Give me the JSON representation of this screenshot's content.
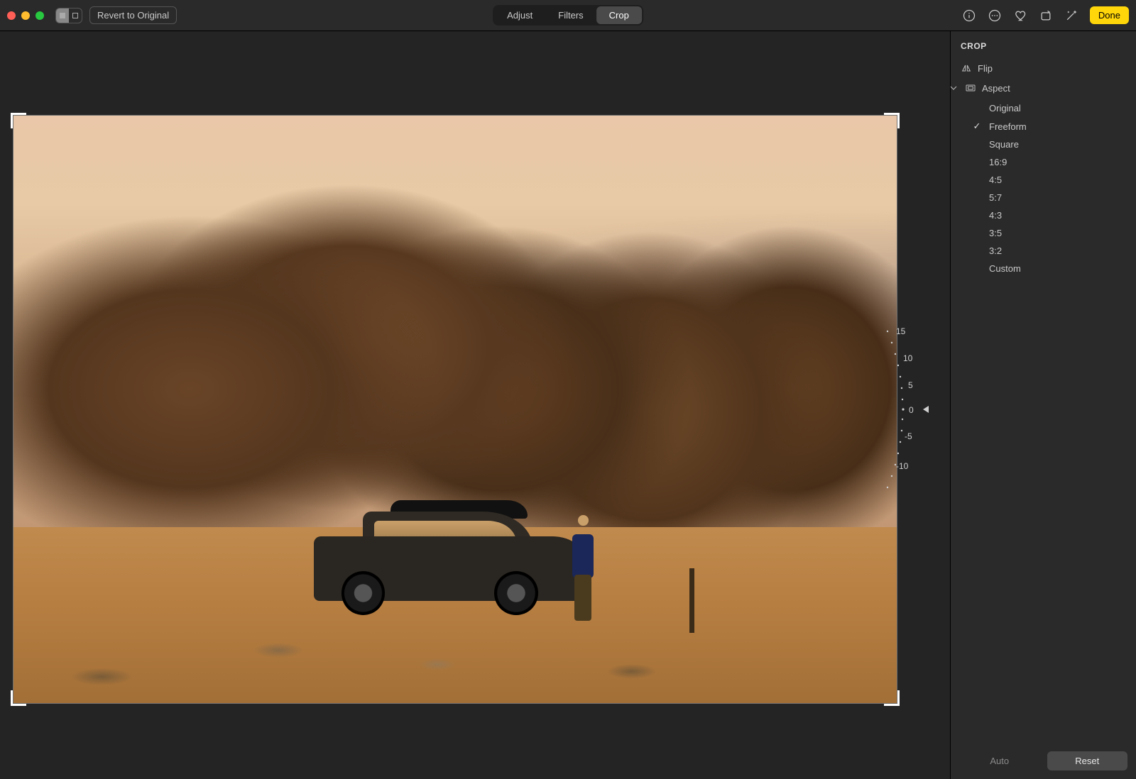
{
  "toolbar": {
    "revert_label": "Revert to Original",
    "tabs": {
      "adjust": "Adjust",
      "filters": "Filters",
      "crop": "Crop",
      "active": "crop"
    },
    "done_label": "Done"
  },
  "crop_panel": {
    "title": "CROP",
    "flip_label": "Flip",
    "aspect_label": "Aspect",
    "aspect_options": [
      {
        "label": "Original",
        "selected": false
      },
      {
        "label": "Freeform",
        "selected": true
      },
      {
        "label": "Square",
        "selected": false
      },
      {
        "label": "16:9",
        "selected": false
      },
      {
        "label": "4:5",
        "selected": false
      },
      {
        "label": "5:7",
        "selected": false
      },
      {
        "label": "4:3",
        "selected": false
      },
      {
        "label": "3:5",
        "selected": false
      },
      {
        "label": "3:2",
        "selected": false
      },
      {
        "label": "Custom",
        "selected": false
      }
    ],
    "auto_label": "Auto",
    "reset_label": "Reset"
  },
  "dial": {
    "ticks": [
      "15",
      "10",
      "5",
      "0",
      "-5",
      "-10"
    ],
    "current": 0
  },
  "image": {
    "description": "Desert landscape at golden hour with rocky formations and distant hazy mountains. A dark SUV with a roof cargo box is parked on sandy ground; a man in a blue shirt stands beside it. A wooden post is to the right."
  }
}
